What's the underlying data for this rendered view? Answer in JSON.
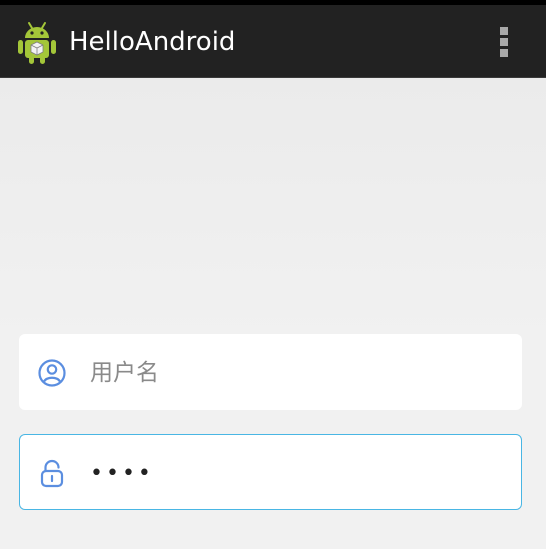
{
  "app": {
    "title": "HelloAndroid",
    "icon": "android-robot-icon",
    "menu_icon": "overflow-menu-icon"
  },
  "form": {
    "username": {
      "placeholder": "用户名",
      "value": "",
      "icon": "user-icon"
    },
    "password": {
      "value": "abcd",
      "icon": "lock-icon",
      "focused": true
    }
  },
  "colors": {
    "action_bar": "#222222",
    "accent": "#49b6e4",
    "icon_blue": "#5b8ee0",
    "android_green": "#a4c639"
  }
}
